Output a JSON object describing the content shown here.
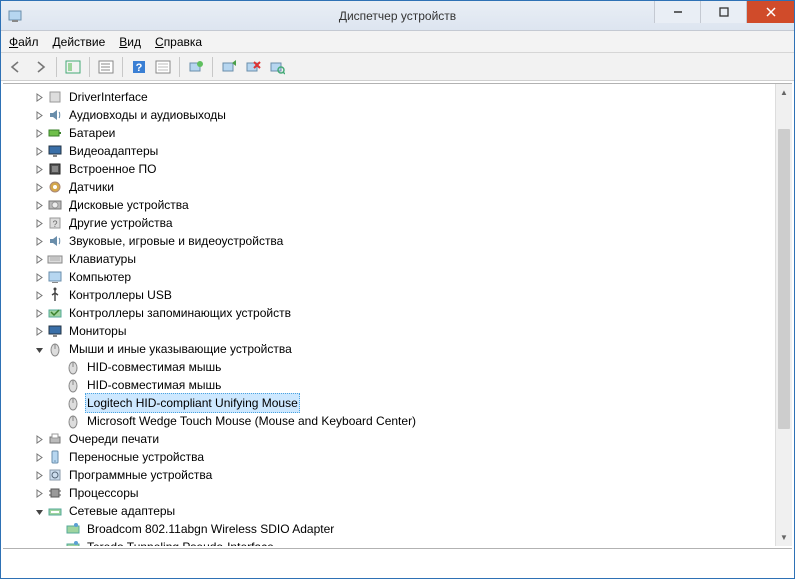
{
  "window": {
    "title": "Диспетчер устройств"
  },
  "menu": {
    "file": "Файл",
    "action": "Действие",
    "view": "Вид",
    "help": "Справка"
  },
  "tree": {
    "items": [
      {
        "depth": 1,
        "exp": "closed",
        "icon": "generic",
        "label": "DriverInterface"
      },
      {
        "depth": 1,
        "exp": "closed",
        "icon": "audio",
        "label": "Аудиовходы и аудиовыходы"
      },
      {
        "depth": 1,
        "exp": "closed",
        "icon": "battery",
        "label": "Батареи"
      },
      {
        "depth": 1,
        "exp": "closed",
        "icon": "display",
        "label": "Видеоадаптеры"
      },
      {
        "depth": 1,
        "exp": "closed",
        "icon": "firmware",
        "label": "Встроенное ПО"
      },
      {
        "depth": 1,
        "exp": "closed",
        "icon": "sensor",
        "label": "Датчики"
      },
      {
        "depth": 1,
        "exp": "closed",
        "icon": "disk",
        "label": "Дисковые устройства"
      },
      {
        "depth": 1,
        "exp": "closed",
        "icon": "other",
        "label": "Другие устройства"
      },
      {
        "depth": 1,
        "exp": "closed",
        "icon": "audio",
        "label": "Звуковые, игровые и видеоустройства"
      },
      {
        "depth": 1,
        "exp": "closed",
        "icon": "keyboard",
        "label": "Клавиатуры"
      },
      {
        "depth": 1,
        "exp": "closed",
        "icon": "computer",
        "label": "Компьютер"
      },
      {
        "depth": 1,
        "exp": "closed",
        "icon": "usb",
        "label": "Контроллеры USB"
      },
      {
        "depth": 1,
        "exp": "closed",
        "icon": "storage",
        "label": "Контроллеры запоминающих устройств"
      },
      {
        "depth": 1,
        "exp": "closed",
        "icon": "monitor",
        "label": "Мониторы"
      },
      {
        "depth": 1,
        "exp": "open",
        "icon": "mouse",
        "label": "Мыши и иные указывающие устройства"
      },
      {
        "depth": 2,
        "exp": "none",
        "icon": "mouse",
        "label": "HID-совместимая мышь"
      },
      {
        "depth": 2,
        "exp": "none",
        "icon": "mouse",
        "label": "HID-совместимая мышь"
      },
      {
        "depth": 2,
        "exp": "none",
        "icon": "mouse",
        "label": "Logitech HID-compliant Unifying Mouse",
        "selected": true
      },
      {
        "depth": 2,
        "exp": "none",
        "icon": "mouse",
        "label": "Microsoft Wedge Touch Mouse (Mouse and Keyboard Center)"
      },
      {
        "depth": 1,
        "exp": "closed",
        "icon": "printer",
        "label": "Очереди печати"
      },
      {
        "depth": 1,
        "exp": "closed",
        "icon": "portable",
        "label": "Переносные устройства"
      },
      {
        "depth": 1,
        "exp": "closed",
        "icon": "software",
        "label": "Программные устройства"
      },
      {
        "depth": 1,
        "exp": "closed",
        "icon": "cpu",
        "label": "Процессоры"
      },
      {
        "depth": 1,
        "exp": "open",
        "icon": "network",
        "label": "Сетевые адаптеры"
      },
      {
        "depth": 2,
        "exp": "none",
        "icon": "netcard",
        "label": "Broadcom 802.11abgn Wireless SDIO Adapter"
      },
      {
        "depth": 2,
        "exp": "none",
        "icon": "netcard",
        "label": "Teredo Tunneling Pseudo-Interface"
      }
    ]
  }
}
